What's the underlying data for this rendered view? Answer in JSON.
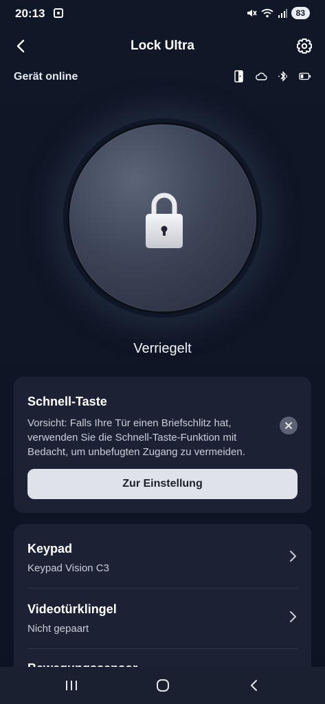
{
  "status_bar": {
    "time": "20:13",
    "battery": "83",
    "icons": [
      "screenshot-icon",
      "mute-icon",
      "wifi-icon",
      "signal-icon"
    ]
  },
  "header": {
    "title": "Lock Ultra"
  },
  "device": {
    "status": "Gerät online",
    "icons": [
      "door-sensor-icon",
      "cloud-icon",
      "bluetooth-icon",
      "battery-icon"
    ]
  },
  "lock": {
    "state": "Verriegelt"
  },
  "quick_key": {
    "title": "Schnell-Taste",
    "text": "Vorsicht: Falls Ihre Tür einen Briefschlitz hat, verwenden Sie die Schnell-Taste-Funktion mit Bedacht, um unbefugten Zugang zu vermeiden.",
    "button_label": "Zur Einstellung"
  },
  "accessories": [
    {
      "title": "Keypad",
      "subtitle": "Keypad Vision C3"
    },
    {
      "title": "Videotürklingel",
      "subtitle": "Nicht gepaart"
    }
  ],
  "accessories_partial": "Bewegungssensor",
  "colors": {
    "background": "#101727",
    "card": "#1c2233",
    "button": "#dfe2e8"
  }
}
